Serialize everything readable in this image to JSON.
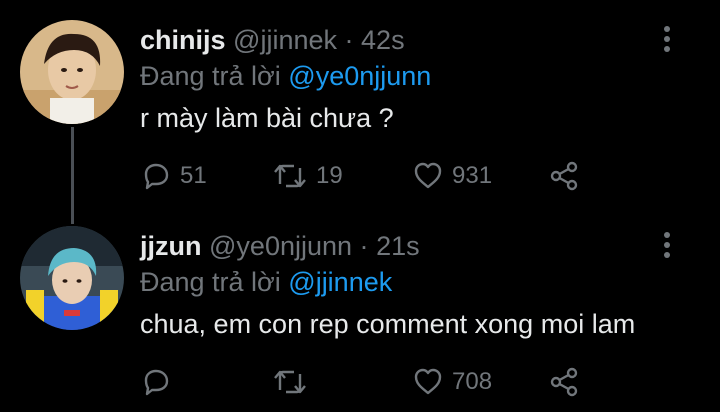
{
  "tweets": [
    {
      "display_name": "chinijs",
      "handle": "@jjinnek",
      "separator": "·",
      "time": "42s",
      "replying_prefix": "Đang trả lời",
      "replying_to": "@ye0njjunn",
      "text": "r mày làm bài chưa ?",
      "reply_count": "51",
      "retweet_count": "19",
      "like_count": "931"
    },
    {
      "display_name": "jjzun",
      "handle": "@ye0njjunn",
      "separator": "·",
      "time": "21s",
      "replying_prefix": "Đang trả lời",
      "replying_to": "@jjinnek",
      "text": "chua, em con rep comment xong moi lam",
      "reply_count": "",
      "retweet_count": "",
      "like_count": "708"
    }
  ],
  "icons": {
    "reply": "reply-icon",
    "retweet": "retweet-icon",
    "like": "heart-icon",
    "share": "share-icon",
    "more": "more-options-icon"
  },
  "colors": {
    "background": "#000000",
    "primary_text": "#e7e9ea",
    "secondary_text": "#71767b",
    "mention": "#1d9bf0",
    "thread_line": "#4a4f55"
  }
}
